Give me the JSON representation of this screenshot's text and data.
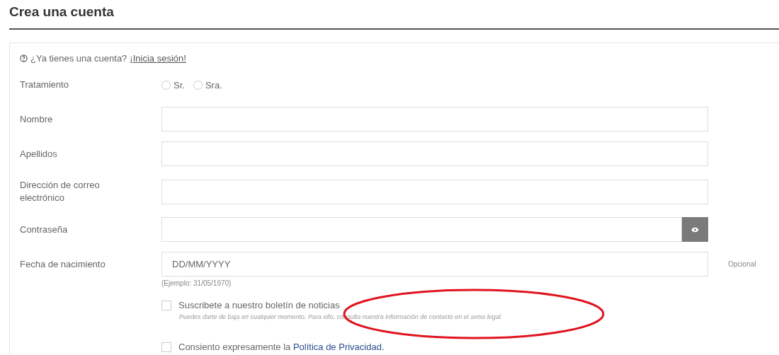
{
  "title": "Crea una cuenta",
  "login_prompt": {
    "text": "¿Ya tienes una cuenta?",
    "link": "¡Inicia sesión!"
  },
  "fields": [
    {
      "kind": "radio",
      "label": "Tratamiento",
      "options": [
        {
          "label": "Sr.",
          "selected": false
        },
        {
          "label": "Sra.",
          "selected": false
        }
      ]
    },
    {
      "kind": "text",
      "label": "Nombre"
    },
    {
      "kind": "text",
      "label": "Apellidos"
    },
    {
      "kind": "text",
      "label": "Dirección de correo electrónico"
    },
    {
      "kind": "password",
      "label": "Contraseña"
    },
    {
      "kind": "text",
      "label": "Fecha de nacimiento",
      "placeholder": "DD/MM/YYYY",
      "hint": "(Ejemplo: 31/05/1970)",
      "note": "Opcional"
    }
  ],
  "checkboxes": [
    {
      "label": "Suscribete a nuestro boletín de noticias",
      "checked": false,
      "help": "Puedes darte de baja en cualquier momento. Para ello, consulta nuestra información de contacto en el aviso legal."
    },
    {
      "label": "Consiento expresamente la",
      "link": "Política de Privacidad.",
      "checked": false
    }
  ]
}
